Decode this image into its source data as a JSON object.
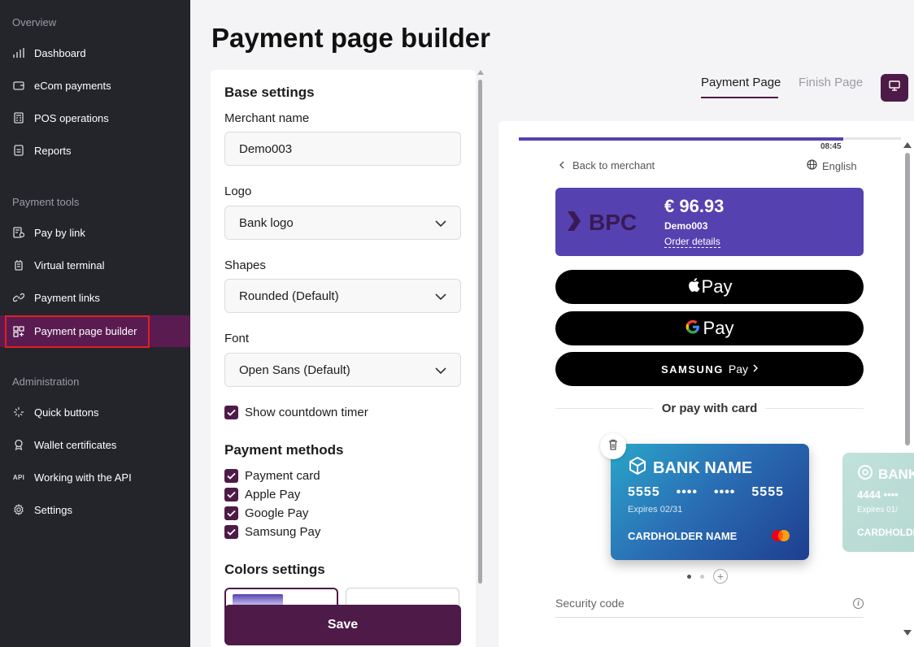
{
  "sidebar": {
    "sections": [
      "Overview",
      "Payment tools",
      "Administration"
    ],
    "overview": [
      {
        "label": "Dashboard",
        "icon": "bar-chart-icon"
      },
      {
        "label": "eCom payments",
        "icon": "wallet-icon"
      },
      {
        "label": "POS operations",
        "icon": "pos-terminal-icon"
      },
      {
        "label": "Reports",
        "icon": "report-icon"
      }
    ],
    "tools": [
      {
        "label": "Pay by link",
        "icon": "pay-link-icon"
      },
      {
        "label": "Virtual terminal",
        "icon": "terminal-icon"
      },
      {
        "label": "Payment links",
        "icon": "link-icon"
      },
      {
        "label": "Payment page builder",
        "icon": "grid-plus-icon"
      }
    ],
    "admin": [
      {
        "label": "Quick buttons",
        "icon": "sparkle-icon"
      },
      {
        "label": "Wallet certificates",
        "icon": "certificate-icon"
      },
      {
        "label": "Working with the API",
        "icon": "api-icon",
        "icon_text": "API"
      },
      {
        "label": "Settings",
        "icon": "gear-icon"
      }
    ],
    "active_item": "Payment page builder"
  },
  "page_title": "Payment page builder",
  "settings": {
    "base_heading": "Base settings",
    "merchant_label": "Merchant name",
    "merchant_value": "Demo003",
    "logo_label": "Logo",
    "logo_value": "Bank logo",
    "shapes_label": "Shapes",
    "shapes_value": "Rounded (Default)",
    "font_label": "Font",
    "font_value": "Open Sans (Default)",
    "countdown_label": "Show countdown timer",
    "methods_heading": "Payment methods",
    "methods": [
      "Payment card",
      "Apple Pay",
      "Google Pay",
      "Samsung Pay"
    ],
    "colors_heading": "Colors settings",
    "save_label": "Save"
  },
  "tabs": {
    "payment_page": "Payment Page",
    "finish_page": "Finish Page"
  },
  "preview": {
    "timer": "08:45",
    "back_label": "Back to merchant",
    "language": "English",
    "logo_text": "BPC",
    "amount": "€ 96.93",
    "merchant": "Demo003",
    "order_details": "Order details",
    "apple_pay": "Pay",
    "google_pay": "Pay",
    "samsung_brand": "SAMSUNG",
    "samsung_pay": "Pay",
    "or_text": "Or pay with card",
    "card": {
      "bank_name": "BANK NAME",
      "number": [
        "5555",
        "••••",
        "••••",
        "5555"
      ],
      "expires": "Expires 02/31",
      "holder": "CARDHOLDER NAME"
    },
    "card2": {
      "bank_name": "BANK NAME",
      "number": "4444 ••••",
      "expires": "Expires 01/",
      "holder": "CARDHOLDER"
    },
    "security_code": "Security code"
  },
  "colors": {
    "brand": "#4e1a47",
    "preview_accent": "#5541b0",
    "sidebar_bg": "#23252b"
  }
}
